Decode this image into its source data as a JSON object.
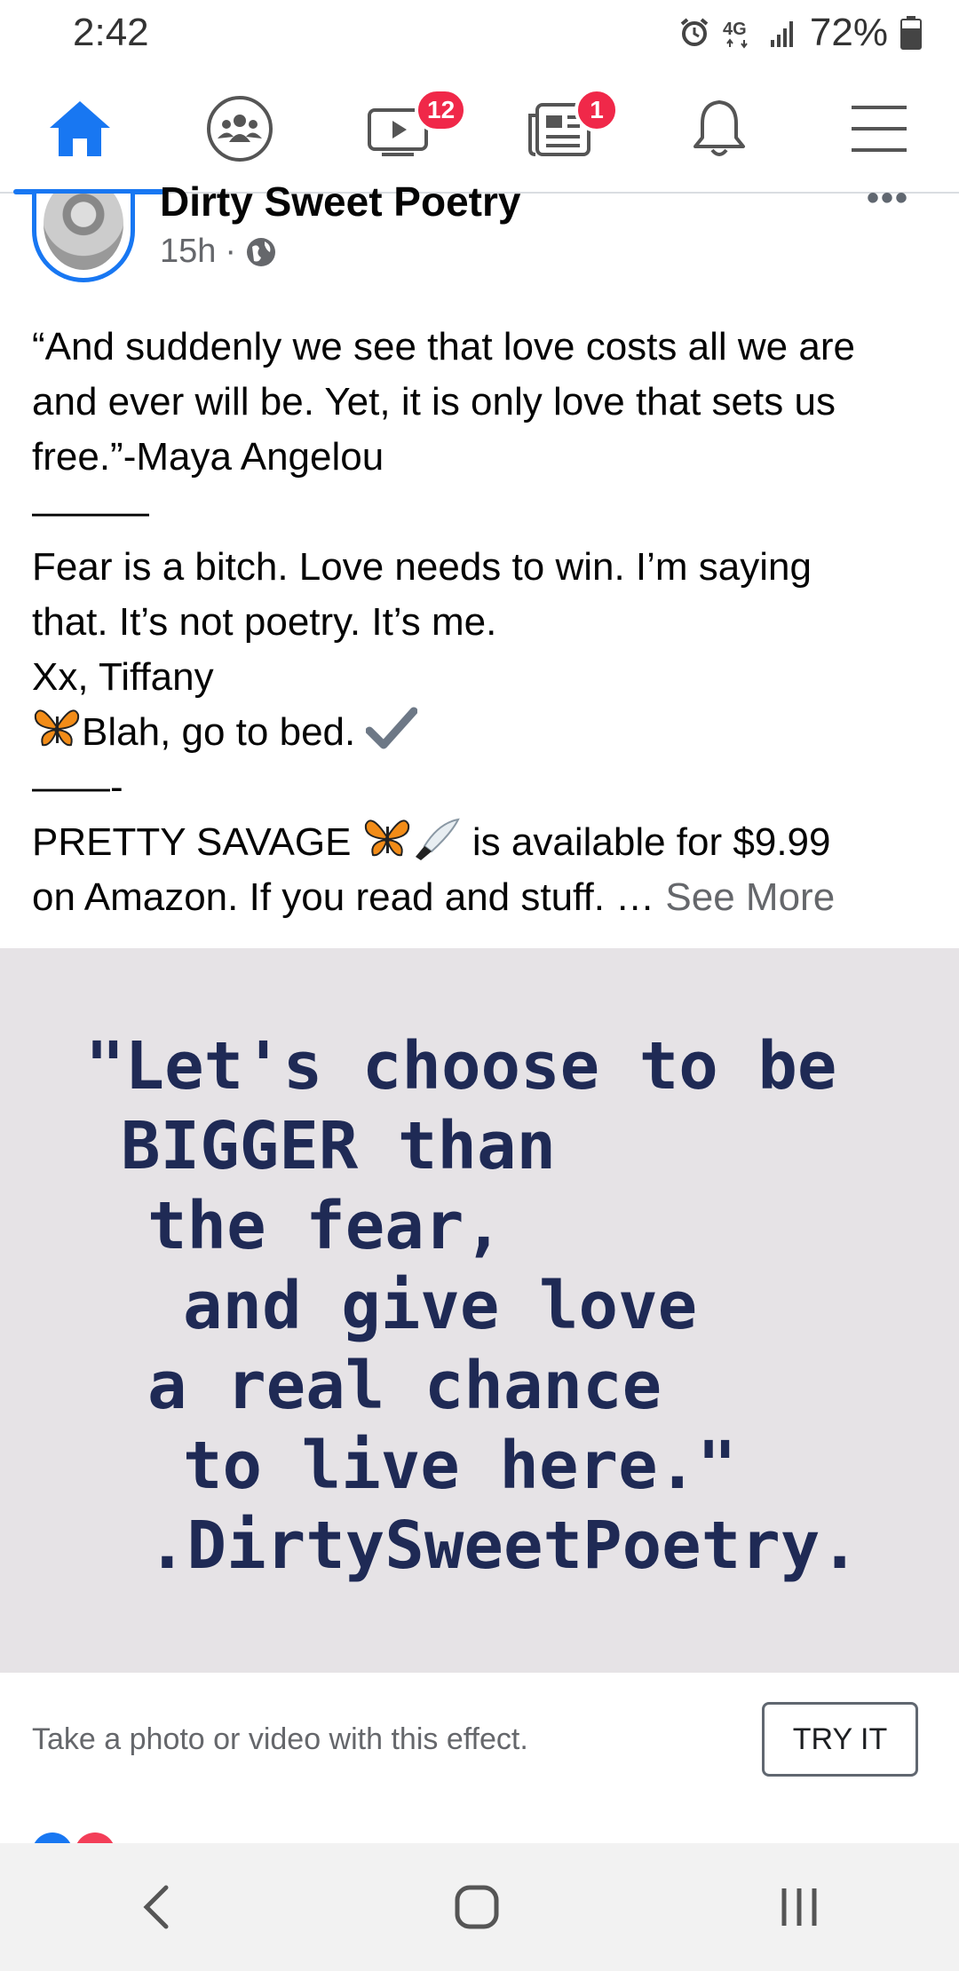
{
  "status_bar": {
    "time": "2:42",
    "battery": "72%"
  },
  "nav": {
    "watch_badge": "12",
    "news_badge": "1",
    "accent_color": "#1877f2",
    "badge_color": "#f02849"
  },
  "post": {
    "page_name": "Dirty Sweet Poetry",
    "time": "15h",
    "text_lines": [
      "“And suddenly we see that love costs all we are",
      "and ever will be.  Yet, it is only love that sets us",
      "free.”-Maya Angelou",
      "———",
      "Fear is a bitch. Love needs to win. I’m saying",
      "that.  It’s not poetry.  It’s me.",
      "Xx, Tiffany",
      "Blah, go to bed.",
      "——-",
      "PRETTY SAVAGE",
      "is  available for $9.99",
      "on Amazon.  If you read and stuff. …",
      "See More"
    ],
    "quote_lines": [
      "\"Let's choose to be",
      "BIGGER than",
      "the fear,",
      "and give love",
      "a real chance",
      "to live here.\"",
      ".DirtySweetPoetry."
    ]
  },
  "effect": {
    "text": "Take a photo or video with this effect.",
    "button": "TRY IT"
  }
}
